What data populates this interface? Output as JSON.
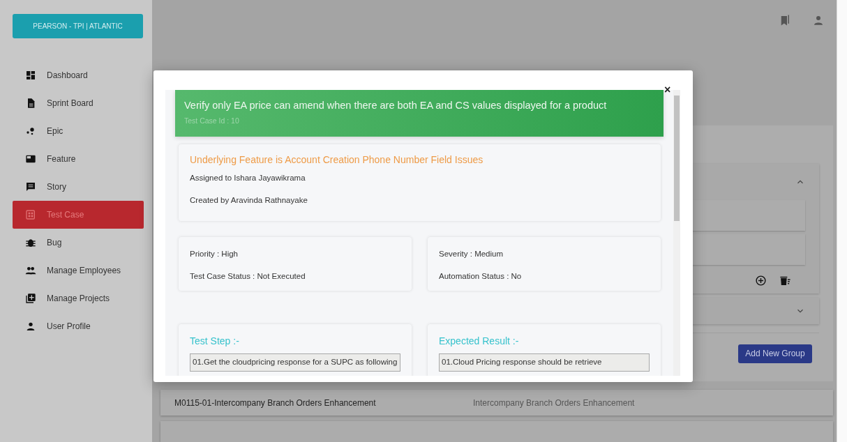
{
  "brand": "PEARSON - TPI | ATLANTIC",
  "sidebar": {
    "items": [
      {
        "label": "Dashboard",
        "selected": false
      },
      {
        "label": "Sprint Board",
        "selected": false
      },
      {
        "label": "Epic",
        "selected": false
      },
      {
        "label": "Feature",
        "selected": false
      },
      {
        "label": "Story",
        "selected": false
      },
      {
        "label": "Test Case",
        "selected": true
      },
      {
        "label": "Bug",
        "selected": false
      },
      {
        "label": "Manage Employees",
        "selected": false
      },
      {
        "label": "Manage Projects",
        "selected": false
      },
      {
        "label": "User Profile",
        "selected": false
      }
    ]
  },
  "groups": [
    {
      "expanded": true
    },
    {
      "expanded": false
    }
  ],
  "add_button": "Add New Group",
  "rows": [
    {
      "name": "M0115-01-Intercompany Branch Orders Enhancement",
      "description": "Intercompany Branch Orders Enhancement"
    }
  ],
  "modal": {
    "title": "Verify only EA price can amend when there are both EA and CS values displayed for a product",
    "subtitle": "Test Case Id : 10",
    "close": "×",
    "feature": "Underlying Feature is Account Creation Phone Number Field Issues",
    "assigned": "Assigned to Ishara Jayawikrama",
    "created": "Created by Aravinda Rathnayake",
    "details_left": [
      "Priority : High",
      "Test Case Status : Not Executed"
    ],
    "details_right": [
      "Severity : Medium",
      "Automation Status : No"
    ],
    "sections": [
      {
        "heading": "Test Step :-",
        "value": "01.Get the cloudpricing response for a SUPC as following"
      },
      {
        "heading": "Expected Result :-",
        "value": "01.Cloud Pricing response should be retrieve"
      }
    ]
  }
}
